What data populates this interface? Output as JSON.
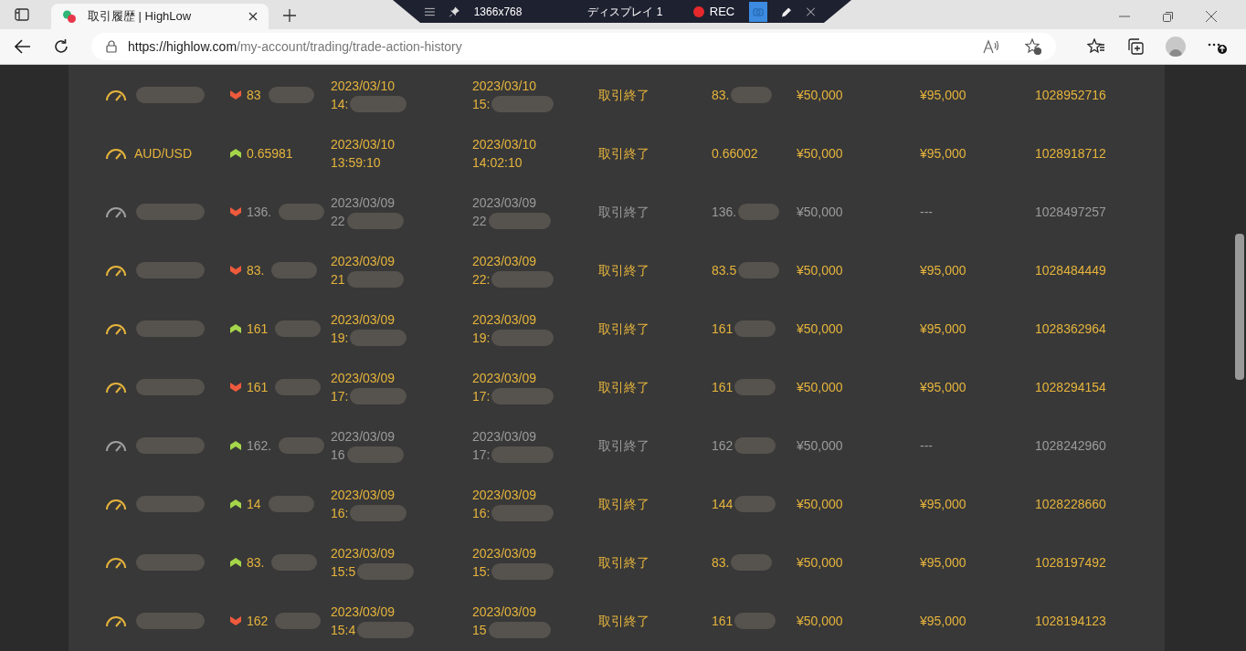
{
  "browser": {
    "tab_title": "取引履歴 | HighLow",
    "url_host": "https://highlow.com",
    "url_path": "/my-account/trading/trade-action-history"
  },
  "recorder": {
    "resolution": "1366x768",
    "display": "ディスプレイ 1",
    "rec": "REC"
  },
  "trades": [
    {
      "kind": "won",
      "rising": false,
      "redacted": true,
      "strike": "83",
      "open_date": "2023/03/10",
      "open_time": "14:",
      "close_date": "2023/03/10",
      "close_time": "15:",
      "status": "取引終了",
      "closing_rate": "83.",
      "amount": "¥50,000",
      "payout": "¥95,000",
      "id": "1028952716"
    },
    {
      "kind": "won",
      "rising": true,
      "redacted": false,
      "asset": "AUD/USD",
      "strike": "0.65981",
      "open_date": "2023/03/10",
      "open_time": "13:59:10",
      "close_date": "2023/03/10",
      "close_time": "14:02:10",
      "status": "取引終了",
      "closing_rate": "0.66002",
      "amount": "¥50,000",
      "payout": "¥95,000",
      "id": "1028918712"
    },
    {
      "kind": "lost",
      "rising": false,
      "redacted": true,
      "strike": "136.",
      "open_date": "2023/03/09",
      "open_time": "22",
      "close_date": "2023/03/09",
      "close_time": "22",
      "status": "取引終了",
      "closing_rate": "136.",
      "amount": "¥50,000",
      "payout": "---",
      "id": "1028497257"
    },
    {
      "kind": "won",
      "rising": false,
      "redacted": true,
      "strike": "83.",
      "open_date": "2023/03/09",
      "open_time": "21",
      "close_date": "2023/03/09",
      "close_time": "22:",
      "status": "取引終了",
      "closing_rate": "83.5",
      "amount": "¥50,000",
      "payout": "¥95,000",
      "id": "1028484449"
    },
    {
      "kind": "won",
      "rising": true,
      "redacted": true,
      "strike": "161",
      "open_date": "2023/03/09",
      "open_time": "19:",
      "close_date": "2023/03/09",
      "close_time": "19:",
      "status": "取引終了",
      "closing_rate": "161",
      "amount": "¥50,000",
      "payout": "¥95,000",
      "id": "1028362964"
    },
    {
      "kind": "won",
      "rising": false,
      "redacted": true,
      "strike": "161",
      "open_date": "2023/03/09",
      "open_time": "17:",
      "close_date": "2023/03/09",
      "close_time": "17:",
      "status": "取引終了",
      "closing_rate": "161",
      "amount": "¥50,000",
      "payout": "¥95,000",
      "id": "1028294154"
    },
    {
      "kind": "lost",
      "rising": true,
      "redacted": true,
      "strike": "162.",
      "open_date": "2023/03/09",
      "open_time": "16",
      "close_date": "2023/03/09",
      "close_time": "17:",
      "status": "取引終了",
      "closing_rate": "162",
      "amount": "¥50,000",
      "payout": "---",
      "id": "1028242960"
    },
    {
      "kind": "won",
      "rising": true,
      "redacted": true,
      "strike": "14",
      "open_date": "2023/03/09",
      "open_time": "16:",
      "close_date": "2023/03/09",
      "close_time": "16:",
      "status": "取引終了",
      "closing_rate": "144",
      "amount": "¥50,000",
      "payout": "¥95,000",
      "id": "1028228660"
    },
    {
      "kind": "won",
      "rising": true,
      "redacted": true,
      "strike": "83.",
      "open_date": "2023/03/09",
      "open_time": "15:5",
      "close_date": "2023/03/09",
      "close_time": "15:",
      "status": "取引終了",
      "closing_rate": "83.",
      "amount": "¥50,000",
      "payout": "¥95,000",
      "id": "1028197492"
    },
    {
      "kind": "won",
      "rising": false,
      "redacted": true,
      "strike": "162",
      "open_date": "2023/03/09",
      "open_time": "15:4",
      "close_date": "2023/03/09",
      "close_time": "15",
      "status": "取引終了",
      "closing_rate": "161",
      "amount": "¥50,000",
      "payout": "¥95,000",
      "id": "1028194123"
    }
  ]
}
